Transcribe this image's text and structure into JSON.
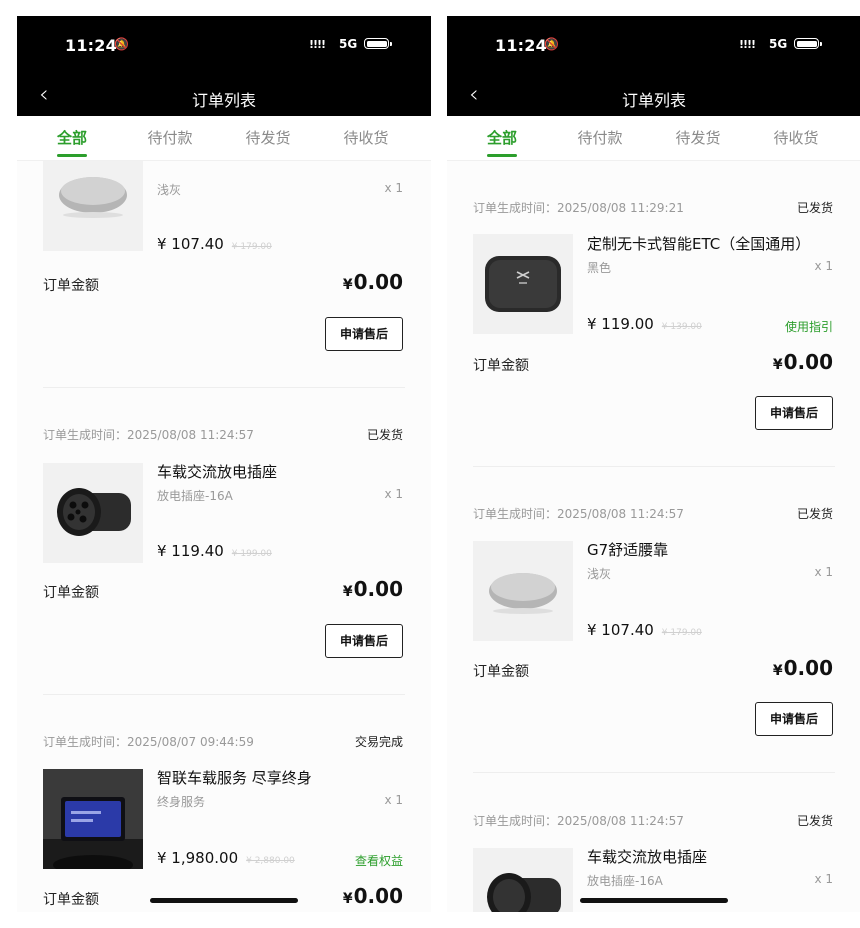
{
  "status_bar": {
    "time": "11:24",
    "signal": "!!!!",
    "network": "5G"
  },
  "nav": {
    "title": "订单列表"
  },
  "tabs": [
    "全部",
    "待付款",
    "待发货",
    "待收货"
  ],
  "common": {
    "amount_label": "订单金额",
    "currency": "¥",
    "amount_value": "0.00",
    "aftersale_button": "申请售后"
  },
  "left_screen": {
    "partial_order": {
      "spec": "浅灰",
      "qty": "x 1",
      "price": "¥ 107.40",
      "orig_price": "¥ 179.00"
    },
    "orders": [
      {
        "time": "订单生成时间：2025/08/08 11:24:57",
        "status": "已发货",
        "name": "车载交流放电插座",
        "spec": "放电插座-16A",
        "qty": "x 1",
        "price": "¥ 119.40",
        "orig_price": "¥ 199.00"
      },
      {
        "time": "订单生成时间：2025/08/07 09:44:59",
        "status": "交易完成",
        "name": "智联车载服务 尽享终身",
        "spec": "终身服务",
        "qty": "x 1",
        "price": "¥ 1,980.00",
        "orig_price": "¥ 2,880.00",
        "link": "查看权益"
      }
    ]
  },
  "right_screen": {
    "orders": [
      {
        "time": "订单生成时间：2025/08/08 11:29:21",
        "status": "已发货",
        "name": "定制无卡式智能ETC（全国通用）",
        "spec": "黑色",
        "qty": "x 1",
        "price": "¥ 119.00",
        "orig_price": "¥ 139.00",
        "link": "使用指引"
      },
      {
        "time": "订单生成时间：2025/08/08 11:24:57",
        "status": "已发货",
        "name": "G7舒适腰靠",
        "spec": "浅灰",
        "qty": "x 1",
        "price": "¥ 107.40",
        "orig_price": "¥ 179.00"
      },
      {
        "time": "订单生成时间：2025/08/08 11:24:57",
        "status": "已发货",
        "name": "车载交流放电插座",
        "spec": "放电插座-16A",
        "qty": "x 1"
      }
    ]
  },
  "icons": {
    "back": "chevron-left-icon",
    "bell": "bell-slash-icon",
    "battery": "battery-icon"
  }
}
